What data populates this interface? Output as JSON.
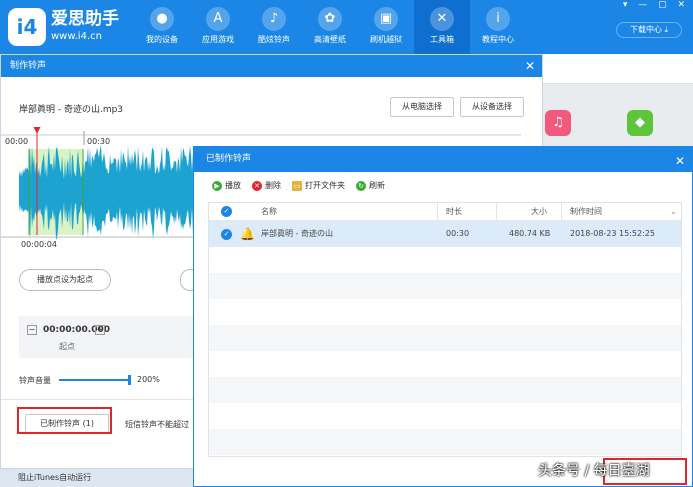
{
  "brand": {
    "logo": "i4",
    "name": "爱思助手",
    "url": "www.i4.cn"
  },
  "nav": [
    {
      "label": "我的设备",
      "icon": ""
    },
    {
      "label": "应用游戏",
      "icon": "A"
    },
    {
      "label": "酷炫铃声",
      "icon": ""
    },
    {
      "label": "高清壁纸",
      "icon": ""
    },
    {
      "label": "刷机越狱",
      "icon": ""
    },
    {
      "label": "工具箱",
      "icon": ""
    },
    {
      "label": "教程中心",
      "icon": "i"
    }
  ],
  "download_center": "下载中心",
  "ringtone_dialog": {
    "title": "制作铃声",
    "file_name": "岸部眞明 - 奇迹の山.mp3",
    "from_pc": "从电脑选择",
    "from_device": "从设备选择",
    "time_start": "00:00",
    "time_mid": "00:30",
    "time_cursor": "00:00:04",
    "set_start_btn": "播放点设为起点",
    "start_time_value": "00:00:00.000",
    "start_label": "起点",
    "volume_label": "铃声音量",
    "volume_value": "200%",
    "volume_level": 1.0,
    "made_btn": "已制作铃声 (1)",
    "sms_note": "短信铃声不能超过"
  },
  "made_dialog": {
    "title": "已制作铃声",
    "toolbar": {
      "play": "播放",
      "delete": "删除",
      "open_folder": "打开文件夹",
      "refresh": "刷新"
    },
    "columns": {
      "name": "名称",
      "duration": "时长",
      "size": "大小",
      "created": "制作时间"
    },
    "rows": [
      {
        "name": "岸部眞明 - 奇迹の山",
        "duration": "00:30",
        "size": "480.74 KB",
        "created": "2018-08-23 15:52:25"
      }
    ]
  },
  "status": {
    "itunes": "阻止iTunes自动运行"
  },
  "watermark": "头条号 / 每日臺湖",
  "colors": {
    "accent": "#1b86e6",
    "highlight": "#e0262c",
    "wave": "#1da3cf"
  }
}
